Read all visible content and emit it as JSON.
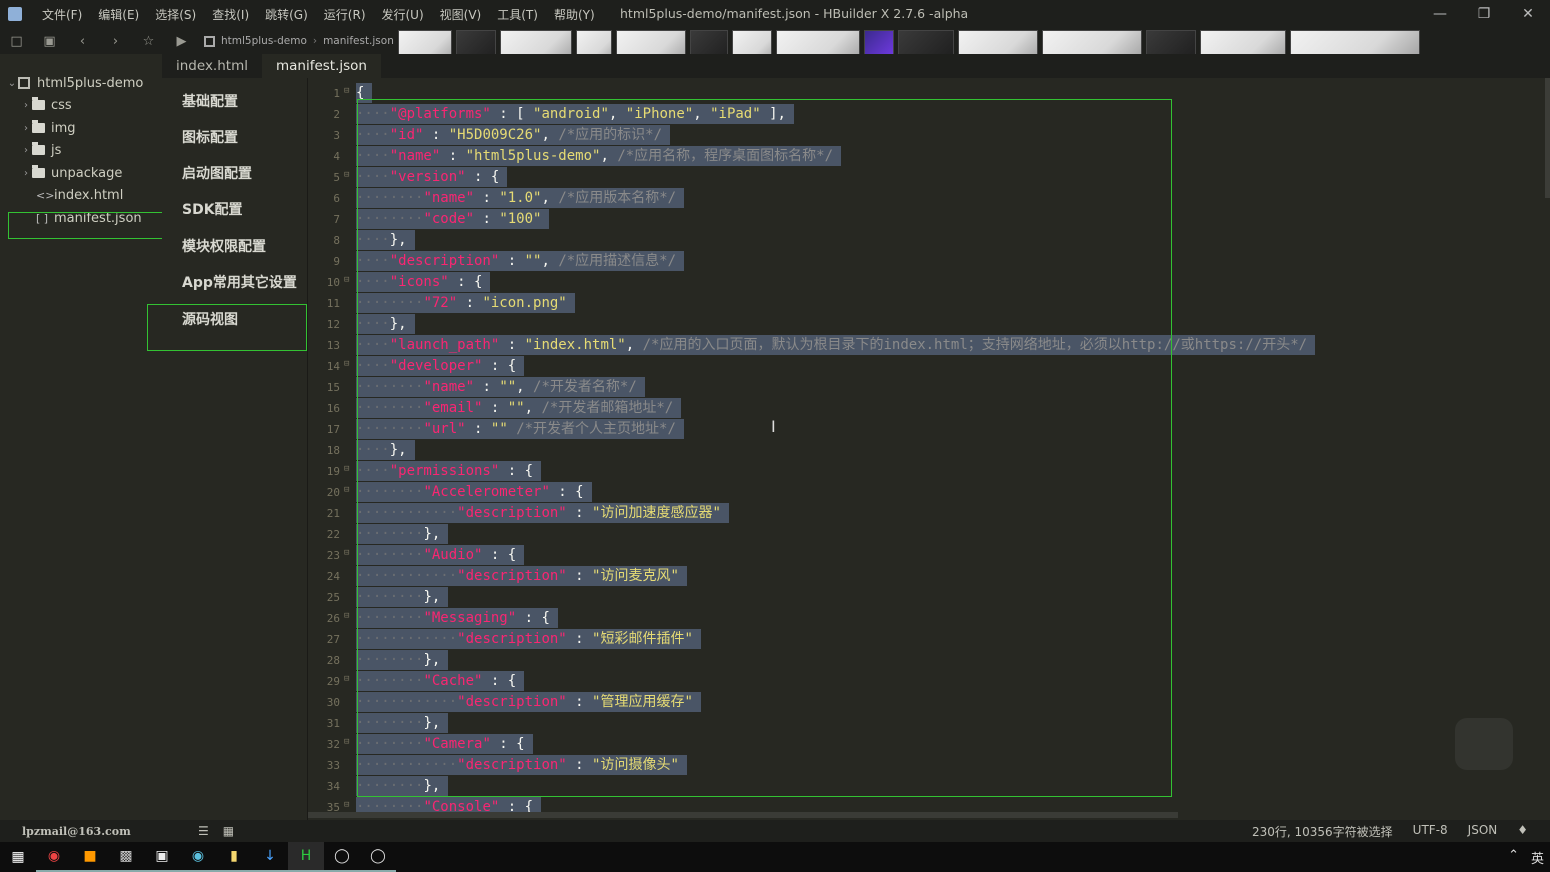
{
  "window": {
    "title": "html5plus-demo/manifest.json - HBuilder X 2.7.6 -alpha",
    "menu": [
      "文件(F)",
      "编辑(E)",
      "选择(S)",
      "查找(I)",
      "跳转(G)",
      "运行(R)",
      "发行(U)",
      "视图(V)",
      "工具(T)",
      "帮助(Y)"
    ],
    "controls": [
      "minimize-icon",
      "restore-icon",
      "close-icon"
    ]
  },
  "toolbar": {
    "breadcrumb": [
      "html5plus-demo",
      "manifest.json"
    ]
  },
  "tree": {
    "project": "html5plus-demo",
    "items": [
      {
        "label": "css",
        "type": "folder"
      },
      {
        "label": "img",
        "type": "folder"
      },
      {
        "label": "js",
        "type": "folder"
      },
      {
        "label": "unpackage",
        "type": "folder"
      },
      {
        "label": "index.html",
        "type": "html"
      },
      {
        "label": "manifest.json",
        "type": "json"
      }
    ]
  },
  "tabs": [
    {
      "label": "index.html",
      "active": false
    },
    {
      "label": "manifest.json",
      "active": true
    }
  ],
  "settings_nav": [
    "基础配置",
    "图标配置",
    "启动图配置",
    "SDK配置",
    "模块权限配置",
    "App常用其它设置",
    "源码视图"
  ],
  "editor": {
    "language": "JSON",
    "selection_color": "#4a5566",
    "lines": [
      "{",
      "\"@platforms\" : [ \"android\", \"iPhone\", \"iPad\" ],",
      "\"id\" : \"H5D009C26\", /*应用的标识*/",
      "\"name\" : \"html5plus-demo\", /*应用名称，程序桌面图标名称*/",
      "\"version\" : {",
      "\"name\" : \"1.0\", /*应用版本名称*/",
      "\"code\" : \"100\"",
      "},",
      "\"description\" : \"\", /*应用描述信息*/",
      "\"icons\" : {",
      "\"72\" : \"icon.png\"",
      "},",
      "\"launch_path\" : \"index.html\", /*应用的入口页面，默认为根目录下的index.html；支持网络地址，必须以http://或https://开头*/",
      "\"developer\" : {",
      "\"name\" : \"\", /*开发者名称*/",
      "\"email\" : \"\", /*开发者邮箱地址*/",
      "\"url\" : \"\" /*开发者个人主页地址*/",
      "},",
      "\"permissions\" : {",
      "\"Accelerometer\" : {",
      "\"description\" : \"访问加速度感应器\"",
      "},",
      "\"Audio\" : {",
      "\"description\" : \"访问麦克风\"",
      "},",
      "\"Messaging\" : {",
      "\"description\" : \"短彩邮件插件\"",
      "},",
      "\"Cache\" : {",
      "\"description\" : \"管理应用缓存\"",
      "},",
      "\"Camera\" : {",
      "\"description\" : \"访问摄像头\"",
      "},",
      "\"Console\" : {"
    ]
  },
  "statusbar": {
    "user": "lpzmail@163.com",
    "selection": "230行, 10356字符被选择",
    "encoding": "UTF-8",
    "language": "JSON"
  },
  "taskbar": {
    "ime": "英"
  }
}
